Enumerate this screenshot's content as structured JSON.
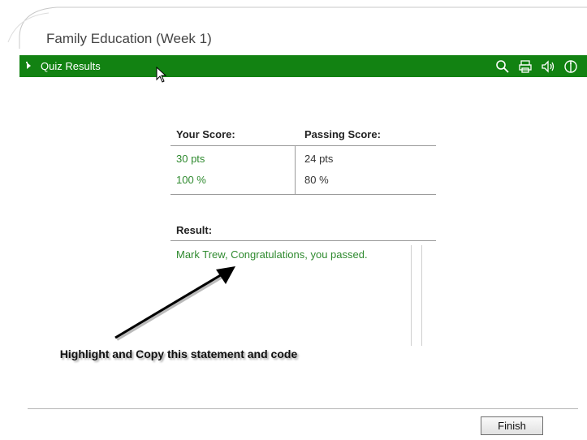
{
  "window": {
    "title": "Family Education (Week 1)"
  },
  "toolbar": {
    "label": "Quiz Results",
    "icons": [
      "search-icon",
      "print-icon",
      "audio-icon",
      "info-icon"
    ]
  },
  "scores": {
    "your_score_header": "Your Score:",
    "passing_score_header": "Passing Score:",
    "your_points": "30 pts",
    "your_percent": "100 %",
    "passing_points": "24 pts",
    "passing_percent": "80 %"
  },
  "result": {
    "label": "Result:",
    "text": "Mark Trew, Congratulations, you passed."
  },
  "annotation": {
    "text": "Highlight and Copy this statement and code"
  },
  "footer": {
    "finish_label": "Finish"
  },
  "colors": {
    "bar": "#128212",
    "pass_text": "#2f8a2f"
  }
}
